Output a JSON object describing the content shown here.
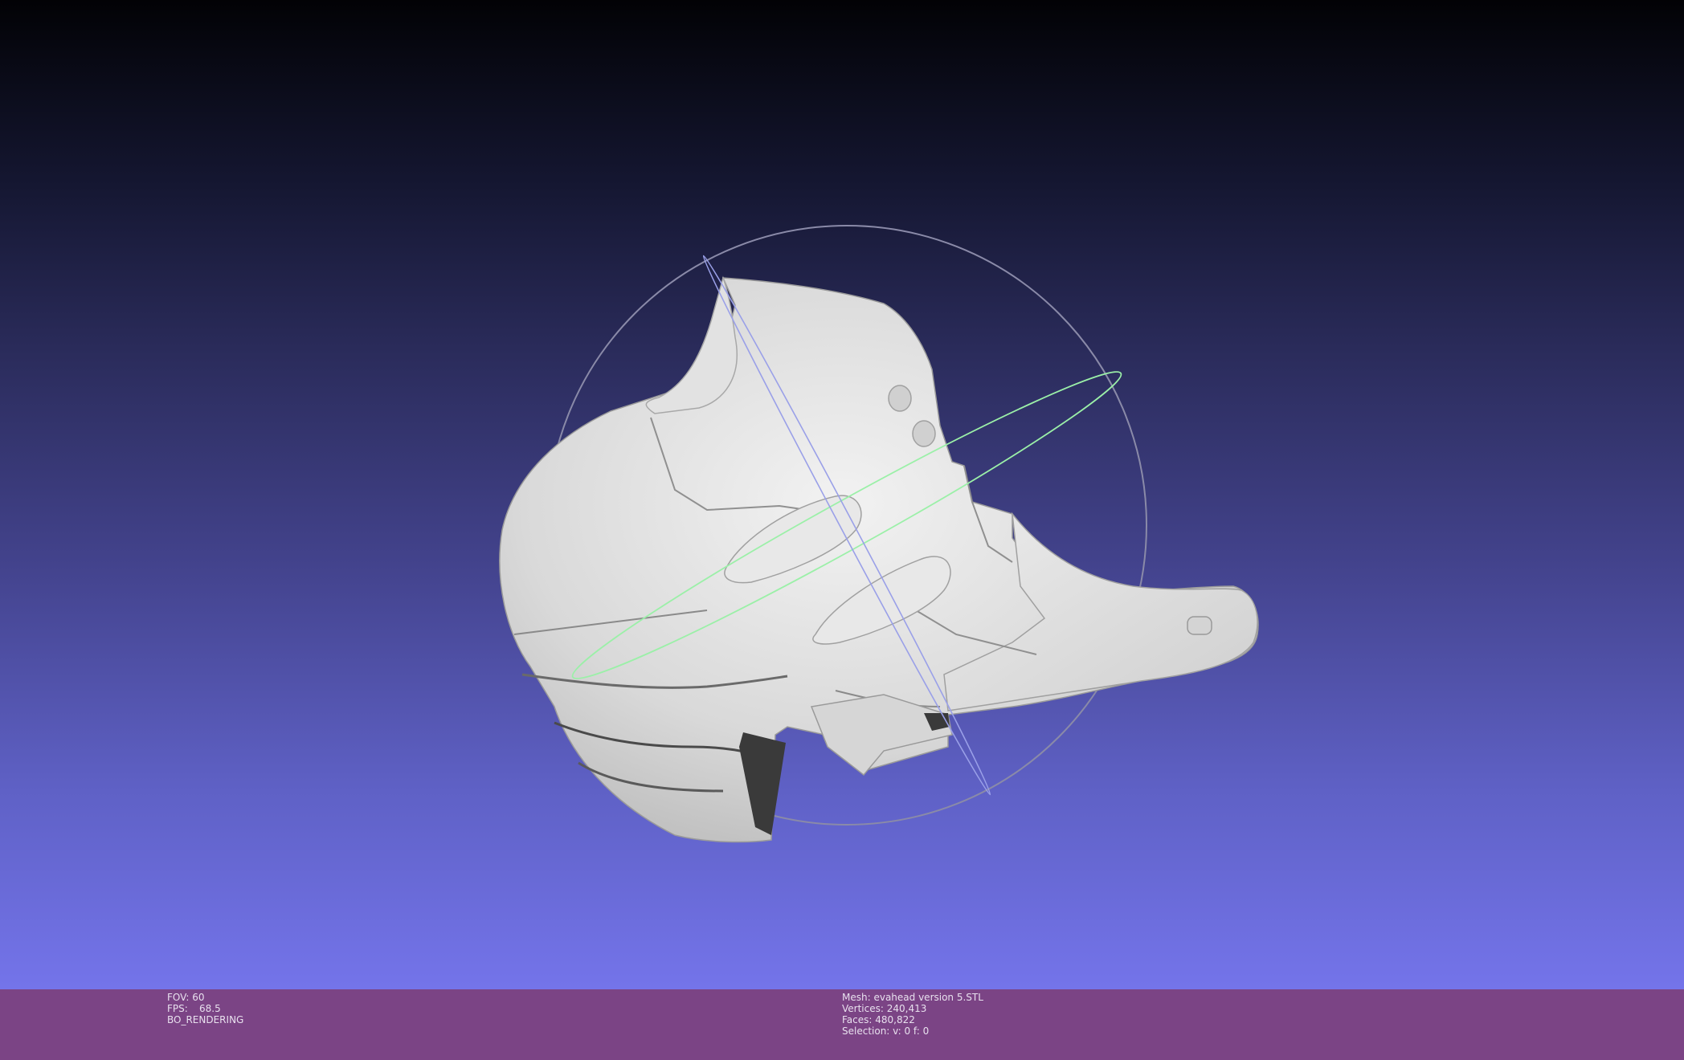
{
  "viewer": {
    "background_top": "#020205",
    "background_bottom": "#7474ea",
    "statusbar_color": "#7b4485",
    "gizmo_colors": {
      "x_ring": "#9aa0e8",
      "y_ring": "#9bf0a8",
      "z_ring": "#8a8aa8"
    }
  },
  "status_left": {
    "fov_label": "FOV:",
    "fov_value": "60",
    "fps_label": "FPS:",
    "fps_value": "68.5",
    "render_mode": "BO_RENDERING"
  },
  "status_right": {
    "mesh_label": "Mesh:",
    "mesh_name": "evahead version 5.STL",
    "vertices_label": "Vertices:",
    "vertices_value": "240,413",
    "faces_label": "Faces:",
    "faces_value": "480,822",
    "selection_label": "Selection:",
    "selection_value": "v: 0 f: 0"
  }
}
